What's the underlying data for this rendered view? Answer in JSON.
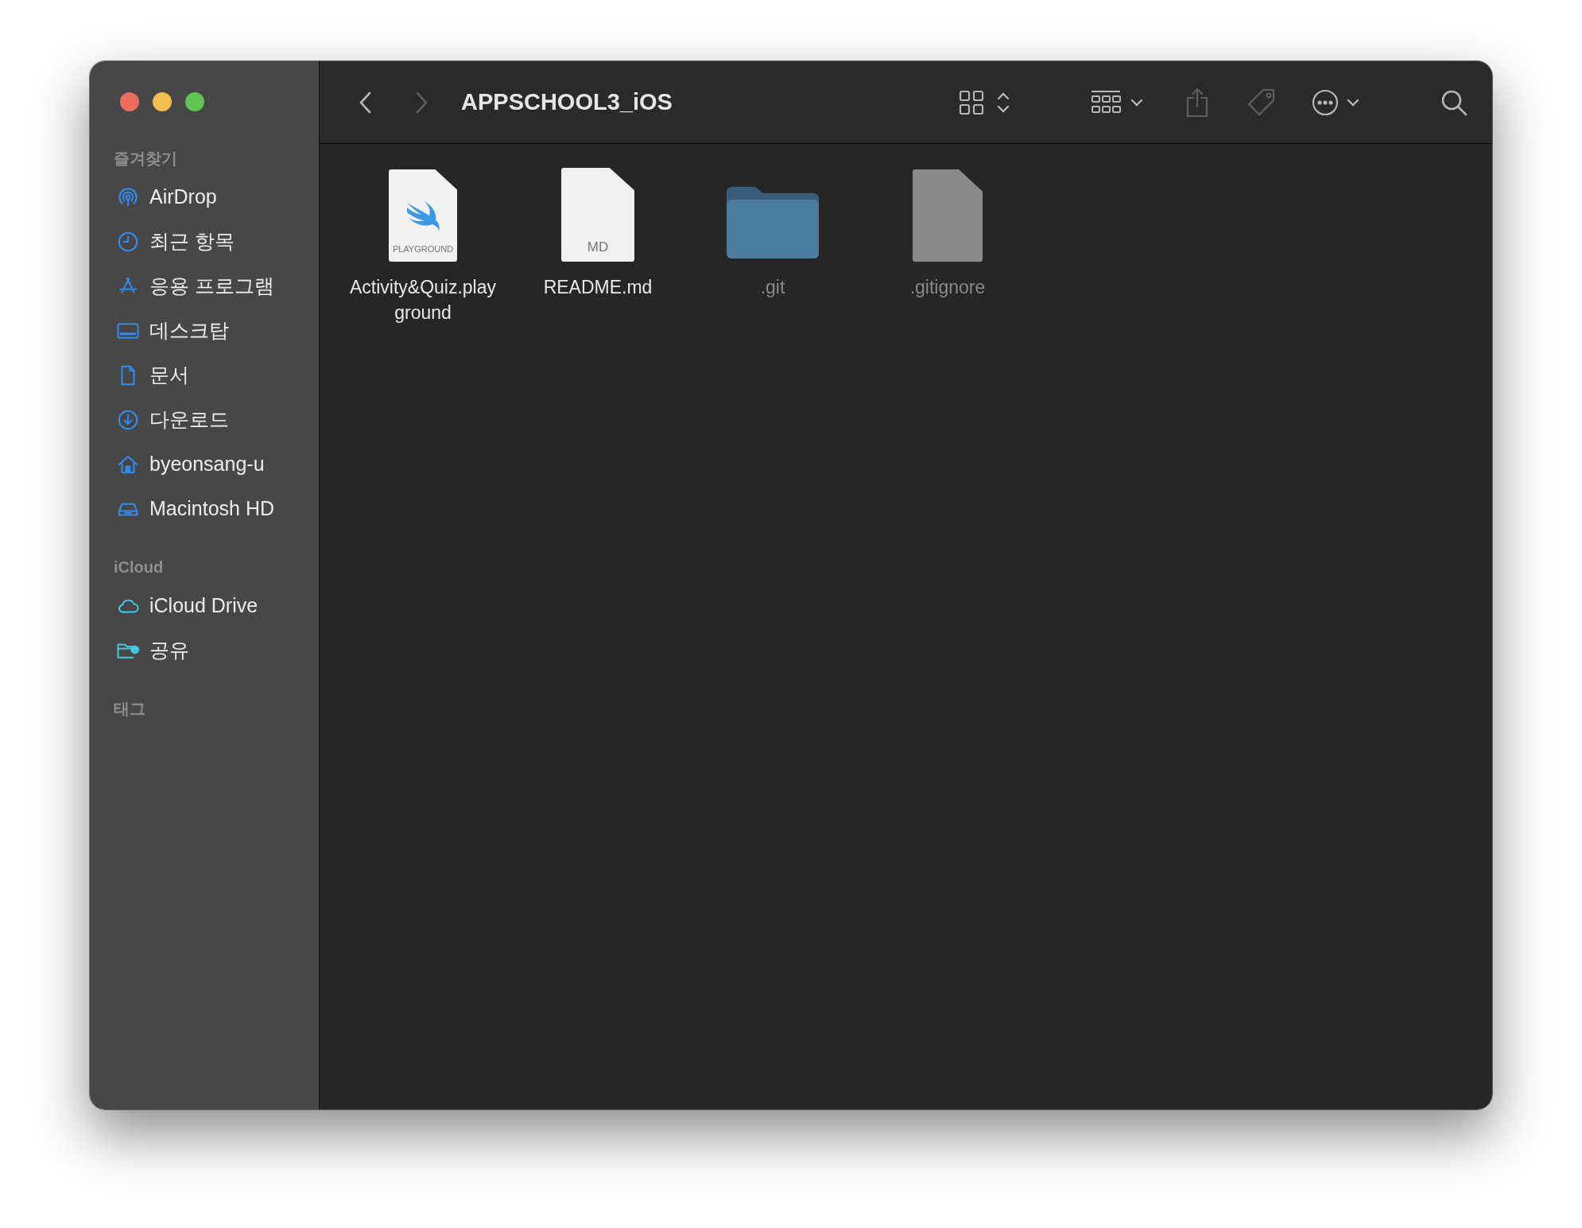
{
  "window": {
    "title": "APPSCHOOL3_iOS"
  },
  "toolbar": {
    "back": {
      "disabled": false
    },
    "forward": {
      "disabled": true
    },
    "share": {
      "disabled": true
    },
    "tags": {
      "disabled": true
    }
  },
  "sidebar": {
    "sections": [
      {
        "heading": "즐겨찾기",
        "items": [
          {
            "label": "AirDrop",
            "kind": "airdrop",
            "color": "#2f8cf0"
          },
          {
            "label": "최근 항목",
            "kind": "recent",
            "color": "#2f8cf0"
          },
          {
            "label": "응용 프로그램",
            "kind": "apps",
            "color": "#2f8cf0"
          },
          {
            "label": "데스크탑",
            "kind": "desktop",
            "color": "#2f8cf0"
          },
          {
            "label": "문서",
            "kind": "document",
            "color": "#2f8cf0"
          },
          {
            "label": "다운로드",
            "kind": "download",
            "color": "#2f8cf0"
          },
          {
            "label": "byeonsang-u",
            "kind": "home",
            "color": "#2f8cf0"
          },
          {
            "label": "Macintosh HD",
            "kind": "disk",
            "color": "#2f8cf0"
          }
        ]
      },
      {
        "heading": "iCloud",
        "items": [
          {
            "label": "iCloud Drive",
            "kind": "cloud",
            "color": "#3ecbe6"
          },
          {
            "label": "공유",
            "kind": "shared",
            "color": "#3ecbe6"
          }
        ]
      },
      {
        "heading": "태그"
      }
    ]
  },
  "files": [
    {
      "name": "Activity&Quiz.play\nground",
      "kind": "playground",
      "badge": "PLAYGROUND",
      "hidden": false
    },
    {
      "name": "README.md",
      "kind": "text",
      "badge": "MD",
      "hidden": false
    },
    {
      "name": ".git",
      "kind": "folder",
      "hidden": true
    },
    {
      "name": ".gitignore",
      "kind": "file",
      "hidden": true
    }
  ]
}
